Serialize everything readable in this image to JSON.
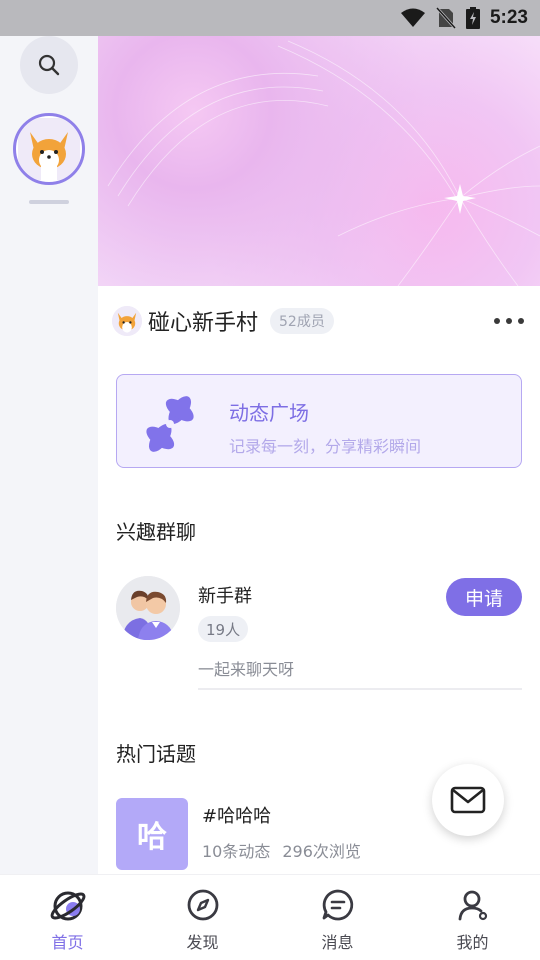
{
  "status_bar": {
    "time": "5:23"
  },
  "rail": {
    "search_icon": "search-icon",
    "avatar": "corgi-avatar"
  },
  "group": {
    "name": "碰心新手村",
    "member_badge": "52成员",
    "more_icon": "more-dots-icon"
  },
  "plaza": {
    "title": "动态广场",
    "subtitle": "记录每一刻，分享精彩瞬间",
    "icon": "pinwheel-icon"
  },
  "interest_section": {
    "title": "兴趣群聊"
  },
  "chats": [
    {
      "name": "新手群",
      "count": "19人",
      "desc": "一起来聊天呀",
      "action": "申请"
    }
  ],
  "hot_section": {
    "title": "热门话题"
  },
  "topics": [
    {
      "thumb_char": "哈",
      "title": "#哈哈哈",
      "posts": "10条动态",
      "views": "296次浏览"
    }
  ],
  "fab": {
    "icon": "mail-icon"
  },
  "nav": {
    "items": [
      {
        "label": "首页",
        "icon": "planet-icon",
        "active": true
      },
      {
        "label": "发现",
        "icon": "compass-icon",
        "active": false
      },
      {
        "label": "消息",
        "icon": "chat-bubble-icon",
        "active": false
      },
      {
        "label": "我的",
        "icon": "user-icon",
        "active": false
      }
    ]
  },
  "colors": {
    "accent": "#7f6fe6",
    "accent_light": "#f3f0fe",
    "rail_bg": "#f4f5f9"
  }
}
